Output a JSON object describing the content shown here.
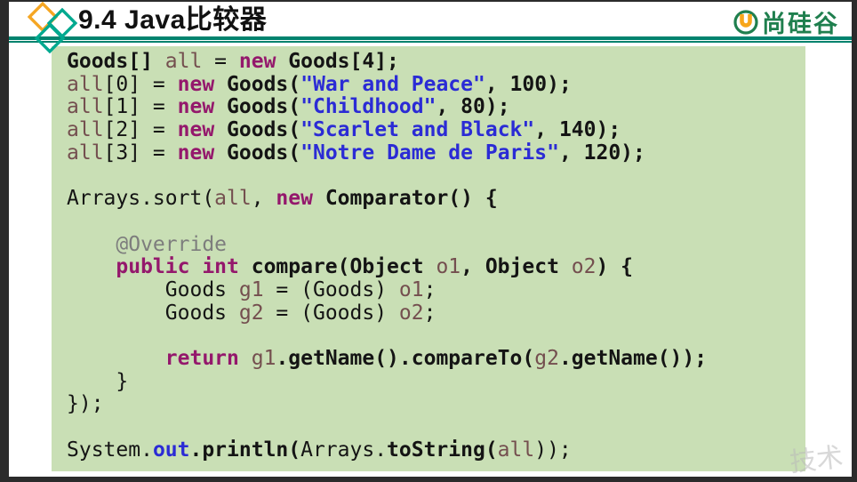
{
  "header": {
    "title": "9.4 Java比较器",
    "brand_text": "尚硅谷"
  },
  "watermark": {
    "text": "技术"
  },
  "colors": {
    "frame": "#2b2b2b",
    "teal_rule": "#00836e",
    "code_bg": "#c9dfb5",
    "brand_green": "#1f7f4e",
    "brand_icon_orange": "#f7a61b",
    "diamond_orange": "#f5a623",
    "diamond_teal": "#00a98f",
    "code_text": "#141414",
    "code_keyword": "#94186c",
    "code_string": "#2b2bd5",
    "code_variable": "#744f4f",
    "code_annotation": "#7d7d7d",
    "code_field": "#2b2bd5"
  },
  "code": {
    "lines": [
      [
        [
          "t",
          "Goods[] "
        ],
        [
          "v",
          "all"
        ],
        [
          "p",
          " = "
        ],
        [
          "k",
          "new"
        ],
        [
          "p",
          " "
        ],
        [
          "t",
          "Goods[4];"
        ]
      ],
      [
        [
          "v",
          "all"
        ],
        [
          "p",
          "[0] = "
        ],
        [
          "k",
          "new"
        ],
        [
          "p",
          " "
        ],
        [
          "t",
          "Goods("
        ],
        [
          "s",
          "\"War and Peace\""
        ],
        [
          "t",
          ", 100);"
        ]
      ],
      [
        [
          "v",
          "all"
        ],
        [
          "p",
          "[1] = "
        ],
        [
          "k",
          "new"
        ],
        [
          "p",
          " "
        ],
        [
          "t",
          "Goods("
        ],
        [
          "s",
          "\"Childhood\""
        ],
        [
          "t",
          ", 80);"
        ]
      ],
      [
        [
          "v",
          "all"
        ],
        [
          "p",
          "[2] = "
        ],
        [
          "k",
          "new"
        ],
        [
          "p",
          " "
        ],
        [
          "t",
          "Goods("
        ],
        [
          "s",
          "\"Scarlet and Black\""
        ],
        [
          "t",
          ", 140);"
        ]
      ],
      [
        [
          "v",
          "all"
        ],
        [
          "p",
          "[3] = "
        ],
        [
          "k",
          "new"
        ],
        [
          "p",
          " "
        ],
        [
          "t",
          "Goods("
        ],
        [
          "s",
          "\"Notre Dame de Paris\""
        ],
        [
          "t",
          ", 120);"
        ]
      ],
      [],
      [
        [
          "p",
          "Arrays.sort("
        ],
        [
          "v",
          "all"
        ],
        [
          "p",
          ", "
        ],
        [
          "k",
          "new"
        ],
        [
          "p",
          " "
        ],
        [
          "t",
          "Comparator() {"
        ]
      ],
      [],
      [
        [
          "c",
          "    @Override"
        ]
      ],
      [
        [
          "k",
          "    public int"
        ],
        [
          "t",
          " compare(Object "
        ],
        [
          "v",
          "o1"
        ],
        [
          "t",
          ", Object "
        ],
        [
          "v",
          "o2"
        ],
        [
          "t",
          ") {"
        ]
      ],
      [
        [
          "p",
          "        Goods "
        ],
        [
          "v",
          "g1"
        ],
        [
          "p",
          " = (Goods) "
        ],
        [
          "v",
          "o1"
        ],
        [
          "p",
          ";"
        ]
      ],
      [
        [
          "p",
          "        Goods "
        ],
        [
          "v",
          "g2"
        ],
        [
          "p",
          " = (Goods) "
        ],
        [
          "v",
          "o2"
        ],
        [
          "p",
          ";"
        ]
      ],
      [],
      [
        [
          "k",
          "        return"
        ],
        [
          "p",
          " "
        ],
        [
          "v",
          "g1"
        ],
        [
          "t",
          ".getName().compareTo("
        ],
        [
          "v",
          "g2"
        ],
        [
          "t",
          ".getName());"
        ]
      ],
      [
        [
          "p",
          "    }"
        ]
      ],
      [
        [
          "p",
          "});"
        ]
      ],
      [],
      [
        [
          "p",
          "System."
        ],
        [
          "f",
          "out"
        ],
        [
          "t",
          ".println("
        ],
        [
          "p",
          "Arrays."
        ],
        [
          "t",
          "toString("
        ],
        [
          "v",
          "all"
        ],
        [
          "p",
          "));"
        ]
      ]
    ]
  }
}
